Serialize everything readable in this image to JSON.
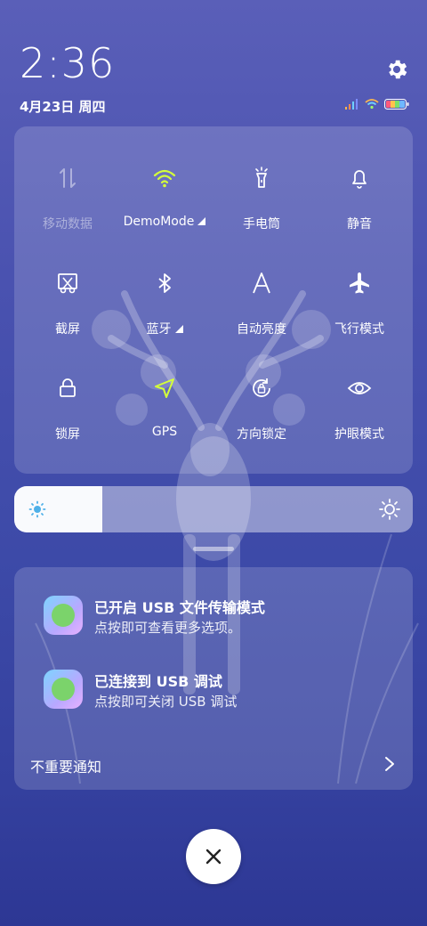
{
  "status_bar": {
    "time": "2:36",
    "date": "4月23日 周四",
    "settings_icon": "gear-icon",
    "signal_icon": "cell-signal-icon",
    "wifi_icon": "wifi-icon",
    "battery_icon": "battery-icon"
  },
  "quick_settings": [
    {
      "label": "移动数据",
      "icon": "mobile-data-icon",
      "state": "disabled"
    },
    {
      "label": "DemoMode",
      "icon": "wifi-icon",
      "state": "on",
      "expandable": true
    },
    {
      "label": "手电筒",
      "icon": "flashlight-icon",
      "state": "off"
    },
    {
      "label": "静音",
      "icon": "bell-icon",
      "state": "off"
    },
    {
      "label": "截屏",
      "icon": "screenshot-icon",
      "state": "off"
    },
    {
      "label": "蓝牙",
      "icon": "bluetooth-icon",
      "state": "off",
      "expandable": true
    },
    {
      "label": "自动亮度",
      "icon": "auto-brightness-icon",
      "state": "off"
    },
    {
      "label": "飞行模式",
      "icon": "airplane-icon",
      "state": "off"
    },
    {
      "label": "锁屏",
      "icon": "lock-icon",
      "state": "off"
    },
    {
      "label": "GPS",
      "icon": "location-arrow-icon",
      "state": "on"
    },
    {
      "label": "方向锁定",
      "icon": "rotation-lock-icon",
      "state": "off"
    },
    {
      "label": "护眼模式",
      "icon": "eye-icon",
      "state": "off"
    }
  ],
  "brightness": {
    "level": 0.22,
    "low_icon": "brightness-low-icon",
    "high_icon": "brightness-high-icon"
  },
  "notifications": [
    {
      "title": "已开启 USB 文件传输模式",
      "body": "点按即可查看更多选项。",
      "icon": "android-app-icon"
    },
    {
      "title": "已连接到 USB 调试",
      "body": "点按即可关闭 USB 调试",
      "icon": "android-app-icon"
    }
  ],
  "less_important": {
    "label": "不重要通知",
    "icon": "chevron-right-icon"
  },
  "close_button": {
    "icon": "close-icon"
  },
  "colors": {
    "accent_on": "#d4ff3a",
    "panel_bg": "rgba(255,255,255,0.16)"
  }
}
